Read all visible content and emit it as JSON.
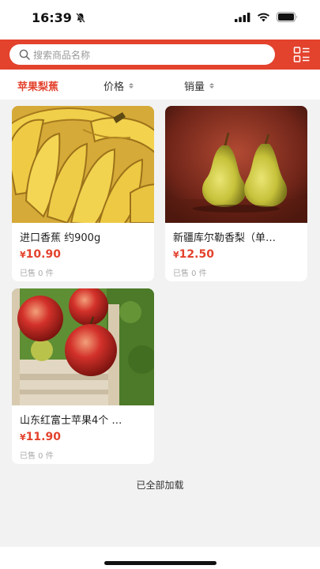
{
  "status": {
    "time": "16:39"
  },
  "search": {
    "placeholder": "搜索商品名称"
  },
  "filters": [
    {
      "label": "苹果梨蕉",
      "active": true
    },
    {
      "label": "价格",
      "active": false
    },
    {
      "label": "销量",
      "active": false
    }
  ],
  "products": [
    {
      "title": "进口香蕉 约900g",
      "currency": "¥",
      "price": "10.90",
      "sold": "已售 0 件",
      "image": "bananas"
    },
    {
      "title": "新疆库尔勒香梨（单…",
      "currency": "¥",
      "price": "12.50",
      "sold": "已售 0 件",
      "image": "pears"
    },
    {
      "title": "山东红富士苹果4个 …",
      "currency": "¥",
      "price": "11.90",
      "sold": "已售 0 件",
      "image": "apples"
    }
  ],
  "footer": {
    "loaded_text": "已全部加载"
  },
  "colors": {
    "brand": "#e3422d",
    "price": "#e3422d",
    "background": "#f2f2f2"
  }
}
